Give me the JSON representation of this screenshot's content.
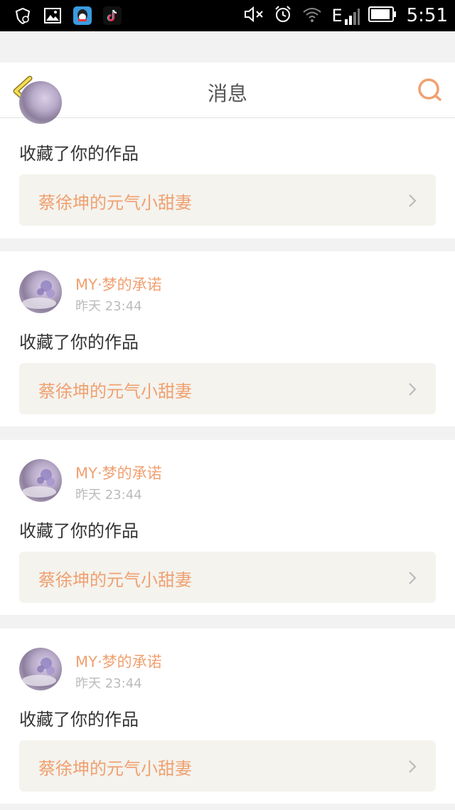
{
  "status_bar": {
    "time": "5:51",
    "left_icons": [
      "shield-icon",
      "gallery-icon",
      "qq-icon",
      "tiktok-icon"
    ],
    "right_icons": [
      "mute-icon",
      "alarm-icon",
      "wifi-icon",
      "signal-icon",
      "battery-icon"
    ],
    "network_label": "E"
  },
  "navbar": {
    "title": "消息",
    "back_icon": "back-chevron-icon",
    "search_icon": "search-icon",
    "accent_color": "#f0a070"
  },
  "messages": [
    {
      "partial": true,
      "action": "收藏了你的作品",
      "work_title": "蔡徐坤的元气小甜妻"
    },
    {
      "user_name": "MY·梦的承诺",
      "time": "昨天 23:44",
      "action": "收藏了你的作品",
      "work_title": "蔡徐坤的元气小甜妻"
    },
    {
      "user_name": "MY·梦的承诺",
      "time": "昨天 23:44",
      "action": "收藏了你的作品",
      "work_title": "蔡徐坤的元气小甜妻"
    },
    {
      "user_name": "MY·梦的承诺",
      "time": "昨天 23:44",
      "action": "收藏了你的作品",
      "work_title": "蔡徐坤的元气小甜妻"
    }
  ]
}
